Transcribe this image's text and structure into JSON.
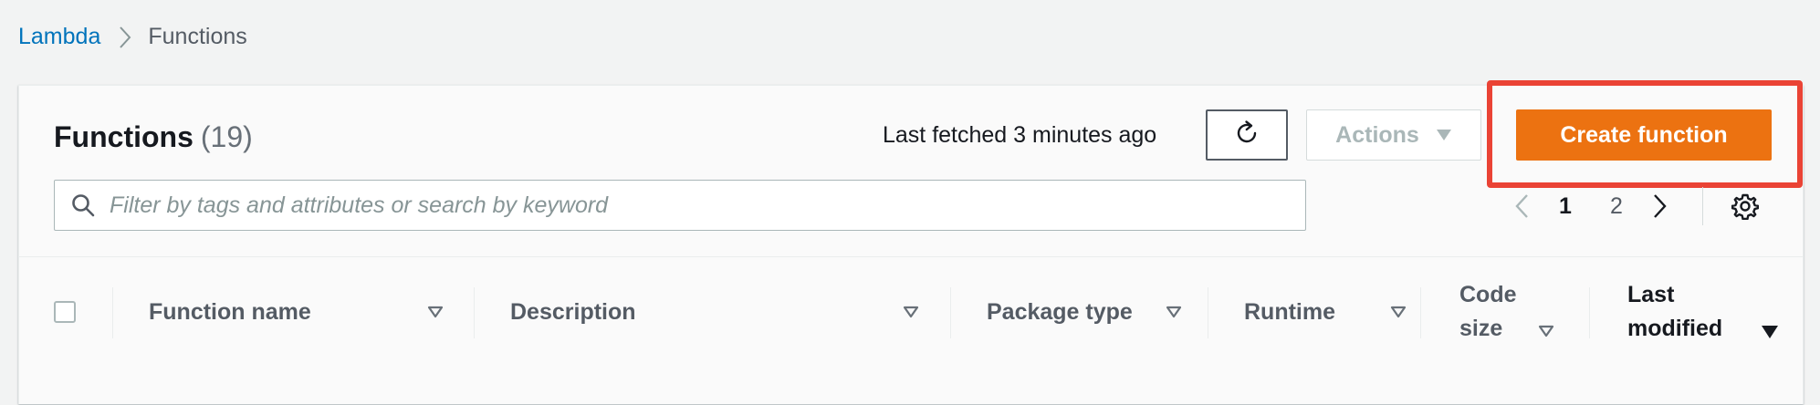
{
  "breadcrumb": {
    "root": "Lambda",
    "current": "Functions"
  },
  "panel": {
    "title": "Functions",
    "count": "(19)",
    "last_fetched": "Last fetched 3 minutes ago",
    "refresh_icon": "refresh-icon",
    "actions_label": "Actions",
    "create_label": "Create function"
  },
  "search": {
    "placeholder": "Filter by tags and attributes or search by keyword",
    "value": ""
  },
  "pagination": {
    "pages": [
      "1",
      "2"
    ],
    "current_page": "1"
  },
  "table": {
    "columns": [
      {
        "label": "Function name",
        "sort_icon": "sort-icon"
      },
      {
        "label": "Description",
        "sort_icon": "sort-icon"
      },
      {
        "label": "Package type",
        "sort_icon": "sort-icon"
      },
      {
        "label": "Runtime",
        "sort_icon": "sort-icon"
      },
      {
        "label_line1": "Code",
        "label_line2": "size",
        "sort_icon": "sort-icon"
      },
      {
        "label_line1": "Last",
        "label_line2": "modified",
        "sort_icon": "sort-descending-icon"
      }
    ]
  },
  "colors": {
    "link": "#0073bb",
    "primary_button": "#ec7211",
    "highlight": "#ea4335"
  }
}
